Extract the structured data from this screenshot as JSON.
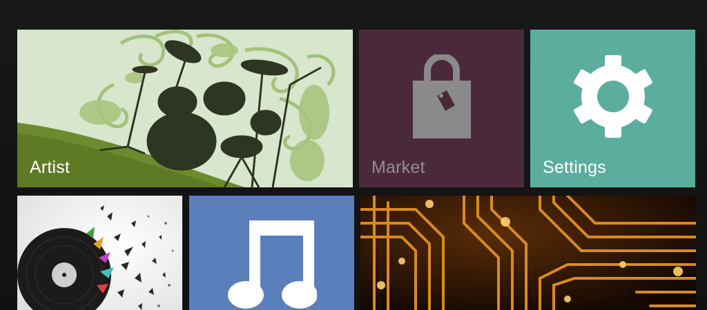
{
  "tiles": {
    "artist": {
      "label": "Artist",
      "image": "drum-kit-illustration"
    },
    "market": {
      "label": "Market",
      "icon": "shopping-bag-icon",
      "color": "#4a2a3a"
    },
    "settings": {
      "label": "Settings",
      "icon": "gear-icon",
      "color": "#5bae9d"
    },
    "vinyl": {
      "image": "shattering-vinyl-record"
    },
    "music": {
      "icon": "music-note-icon",
      "color": "#5b7fbb"
    },
    "circuit": {
      "image": "orange-circuit-board"
    }
  }
}
